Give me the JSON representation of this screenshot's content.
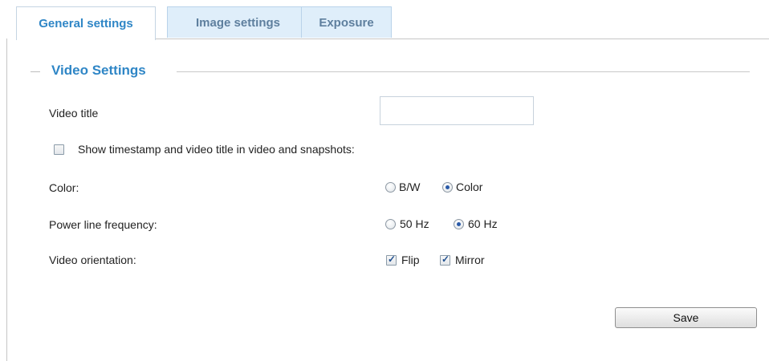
{
  "tabs": [
    {
      "label": "General settings",
      "active": true
    },
    {
      "label": "Image settings",
      "active": false
    },
    {
      "label": "Exposure",
      "active": false
    }
  ],
  "section_title": "Video Settings",
  "video_title": {
    "label": "Video title",
    "value": ""
  },
  "show_timestamp": {
    "label": "Show timestamp and video title in video and snapshots:",
    "checked": false
  },
  "color": {
    "label": "Color:",
    "options": [
      "B/W",
      "Color"
    ],
    "selected": "Color"
  },
  "power_line": {
    "label": "Power line frequency:",
    "options": [
      "50 Hz",
      "60 Hz"
    ],
    "selected": "60 Hz"
  },
  "orientation": {
    "label": "Video orientation:",
    "flip_label": "Flip",
    "flip_checked": true,
    "mirror_label": "Mirror",
    "mirror_checked": true
  },
  "save_label": "Save",
  "colors": {
    "accent": "#2f86c6",
    "tab_bg": "#dfeefa"
  }
}
